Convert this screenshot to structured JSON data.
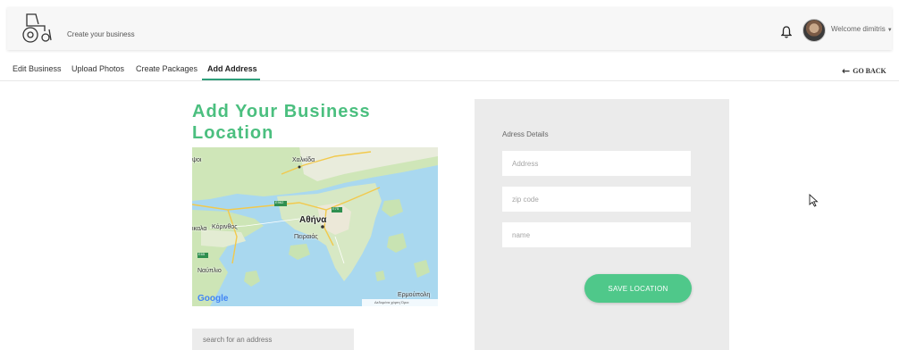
{
  "header": {
    "title": "Create your business",
    "welcome": "Welcome dimitris",
    "icons": {
      "logo": "tractor-logo",
      "notifications": "bell-icon",
      "user": "avatar",
      "menu": "caret-down-icon"
    }
  },
  "tabs": [
    {
      "label": "Edit Business",
      "active": false
    },
    {
      "label": "Upload Photos",
      "active": false
    },
    {
      "label": "Create Packages",
      "active": false
    },
    {
      "label": "Add Address",
      "active": true
    }
  ],
  "go_back": {
    "label": "GO BACK",
    "icon": "arrow-left-icon"
  },
  "main": {
    "title": "Add Your Business Location",
    "map": {
      "labels": [
        "Χαλκίδα",
        "Αθήνα",
        "Πειραιάς",
        "Κόρινθος",
        "Ναύπλιο",
        "Ερμούπολη"
      ],
      "partial_labels": [
        "ψοι",
        "ικαλα"
      ],
      "road_badges": [
        "E962",
        "E75",
        "E65"
      ],
      "attribution": "Google",
      "footer": "Δεδομένα χάρτη  Όροι"
    },
    "search": {
      "placeholder": "search for an address"
    }
  },
  "address_panel": {
    "heading": "Adress Details",
    "fields": [
      {
        "placeholder": "Address",
        "value": ""
      },
      {
        "placeholder": "zip code",
        "value": ""
      },
      {
        "placeholder": "name",
        "value": ""
      }
    ],
    "save_label": "SAVE LOCATION"
  },
  "colors": {
    "accent": "#4bbf7f",
    "button": "#4fc88a",
    "tab_underline": "#2e9e7a",
    "panel_bg": "#ebebeb",
    "header_bg": "#f7f7f7"
  }
}
